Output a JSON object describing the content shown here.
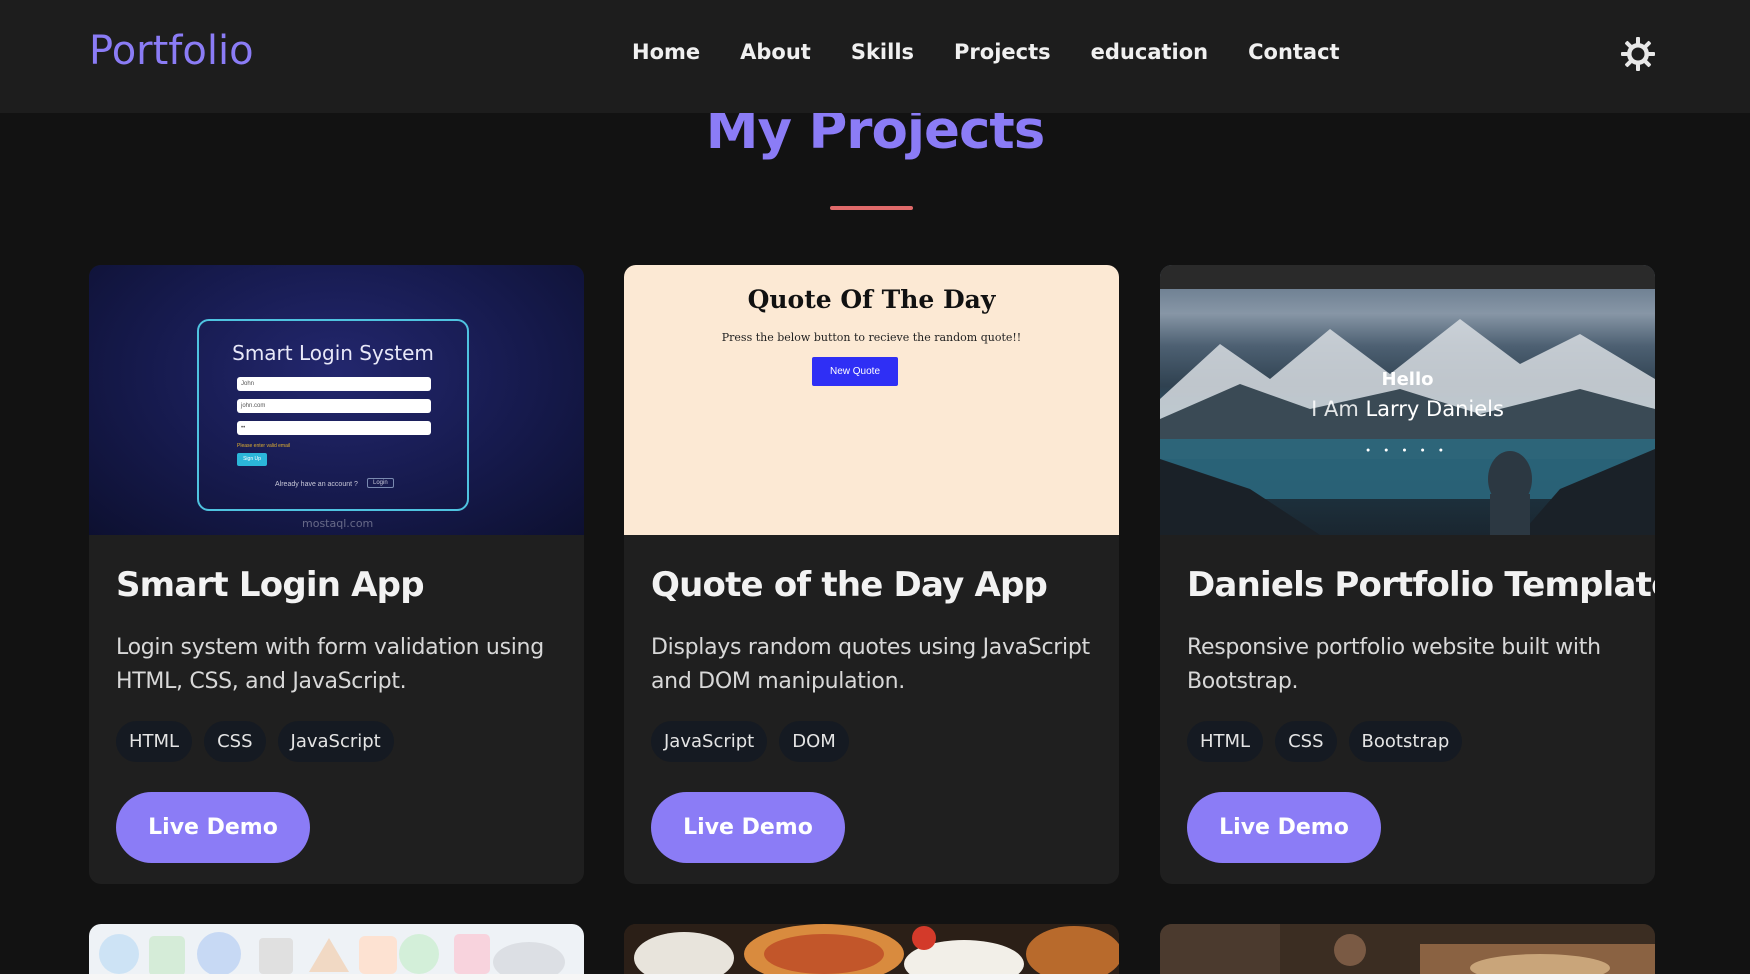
{
  "navbar": {
    "logo": "Portfolio",
    "links": [
      "Home",
      "About",
      "Skills",
      "Projects",
      "education",
      "Contact"
    ],
    "theme_toggle_icon": "sun-icon"
  },
  "section": {
    "title": "My Projects",
    "accent_color": "#8b7cf6",
    "underline_color": "#e06a6a"
  },
  "projects": [
    {
      "title": "Smart Login App",
      "description": "Login system with form validation using HTML, CSS, and JavaScript.",
      "tags": [
        "HTML",
        "CSS",
        "JavaScript"
      ],
      "button": "Live Demo",
      "thumb": {
        "heading": "Smart Login System",
        "inputs": [
          "John",
          "john.com",
          "••"
        ],
        "error_text": "Please enter valid email",
        "submit": "Sign Up",
        "footer_text": "Already have an account ?",
        "login_link": "Login",
        "watermark": "mostaql.com"
      }
    },
    {
      "title": "Quote of the Day App",
      "description": "Displays random quotes using JavaScript and DOM manipulation.",
      "tags": [
        "JavaScript",
        "DOM"
      ],
      "button": "Live Demo",
      "thumb": {
        "heading": "Quote Of The Day",
        "subtext": "Press the below button to recieve the random quote!!",
        "button": "New Quote"
      }
    },
    {
      "title": "Daniels Portfolio Template",
      "description": "Responsive portfolio website built with Bootstrap.",
      "tags": [
        "HTML",
        "CSS",
        "Bootstrap"
      ],
      "button": "Live Demo",
      "thumb": {
        "hello": "Hello",
        "intro": "I Am",
        "name": "Larry Daniels"
      }
    }
  ]
}
